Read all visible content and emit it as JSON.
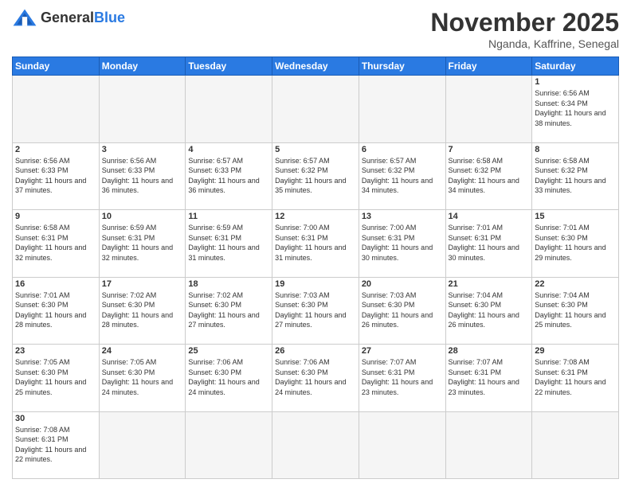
{
  "header": {
    "logo_general": "General",
    "logo_blue": "Blue",
    "month_title": "November 2025",
    "location": "Nganda, Kaffrine, Senegal"
  },
  "weekdays": [
    "Sunday",
    "Monday",
    "Tuesday",
    "Wednesday",
    "Thursday",
    "Friday",
    "Saturday"
  ],
  "days": [
    {
      "date": 1,
      "sunrise": "6:56 AM",
      "sunset": "6:34 PM",
      "daylight": "11 hours and 38 minutes."
    },
    {
      "date": 2,
      "sunrise": "6:56 AM",
      "sunset": "6:33 PM",
      "daylight": "11 hours and 37 minutes."
    },
    {
      "date": 3,
      "sunrise": "6:56 AM",
      "sunset": "6:33 PM",
      "daylight": "11 hours and 36 minutes."
    },
    {
      "date": 4,
      "sunrise": "6:57 AM",
      "sunset": "6:33 PM",
      "daylight": "11 hours and 36 minutes."
    },
    {
      "date": 5,
      "sunrise": "6:57 AM",
      "sunset": "6:32 PM",
      "daylight": "11 hours and 35 minutes."
    },
    {
      "date": 6,
      "sunrise": "6:57 AM",
      "sunset": "6:32 PM",
      "daylight": "11 hours and 34 minutes."
    },
    {
      "date": 7,
      "sunrise": "6:58 AM",
      "sunset": "6:32 PM",
      "daylight": "11 hours and 34 minutes."
    },
    {
      "date": 8,
      "sunrise": "6:58 AM",
      "sunset": "6:32 PM",
      "daylight": "11 hours and 33 minutes."
    },
    {
      "date": 9,
      "sunrise": "6:58 AM",
      "sunset": "6:31 PM",
      "daylight": "11 hours and 32 minutes."
    },
    {
      "date": 10,
      "sunrise": "6:59 AM",
      "sunset": "6:31 PM",
      "daylight": "11 hours and 32 minutes."
    },
    {
      "date": 11,
      "sunrise": "6:59 AM",
      "sunset": "6:31 PM",
      "daylight": "11 hours and 31 minutes."
    },
    {
      "date": 12,
      "sunrise": "7:00 AM",
      "sunset": "6:31 PM",
      "daylight": "11 hours and 31 minutes."
    },
    {
      "date": 13,
      "sunrise": "7:00 AM",
      "sunset": "6:31 PM",
      "daylight": "11 hours and 30 minutes."
    },
    {
      "date": 14,
      "sunrise": "7:01 AM",
      "sunset": "6:31 PM",
      "daylight": "11 hours and 30 minutes."
    },
    {
      "date": 15,
      "sunrise": "7:01 AM",
      "sunset": "6:30 PM",
      "daylight": "11 hours and 29 minutes."
    },
    {
      "date": 16,
      "sunrise": "7:01 AM",
      "sunset": "6:30 PM",
      "daylight": "11 hours and 28 minutes."
    },
    {
      "date": 17,
      "sunrise": "7:02 AM",
      "sunset": "6:30 PM",
      "daylight": "11 hours and 28 minutes."
    },
    {
      "date": 18,
      "sunrise": "7:02 AM",
      "sunset": "6:30 PM",
      "daylight": "11 hours and 27 minutes."
    },
    {
      "date": 19,
      "sunrise": "7:03 AM",
      "sunset": "6:30 PM",
      "daylight": "11 hours and 27 minutes."
    },
    {
      "date": 20,
      "sunrise": "7:03 AM",
      "sunset": "6:30 PM",
      "daylight": "11 hours and 26 minutes."
    },
    {
      "date": 21,
      "sunrise": "7:04 AM",
      "sunset": "6:30 PM",
      "daylight": "11 hours and 26 minutes."
    },
    {
      "date": 22,
      "sunrise": "7:04 AM",
      "sunset": "6:30 PM",
      "daylight": "11 hours and 25 minutes."
    },
    {
      "date": 23,
      "sunrise": "7:05 AM",
      "sunset": "6:30 PM",
      "daylight": "11 hours and 25 minutes."
    },
    {
      "date": 24,
      "sunrise": "7:05 AM",
      "sunset": "6:30 PM",
      "daylight": "11 hours and 24 minutes."
    },
    {
      "date": 25,
      "sunrise": "7:06 AM",
      "sunset": "6:30 PM",
      "daylight": "11 hours and 24 minutes."
    },
    {
      "date": 26,
      "sunrise": "7:06 AM",
      "sunset": "6:30 PM",
      "daylight": "11 hours and 24 minutes."
    },
    {
      "date": 27,
      "sunrise": "7:07 AM",
      "sunset": "6:31 PM",
      "daylight": "11 hours and 23 minutes."
    },
    {
      "date": 28,
      "sunrise": "7:07 AM",
      "sunset": "6:31 PM",
      "daylight": "11 hours and 23 minutes."
    },
    {
      "date": 29,
      "sunrise": "7:08 AM",
      "sunset": "6:31 PM",
      "daylight": "11 hours and 22 minutes."
    },
    {
      "date": 30,
      "sunrise": "7:08 AM",
      "sunset": "6:31 PM",
      "daylight": "11 hours and 22 minutes."
    }
  ]
}
